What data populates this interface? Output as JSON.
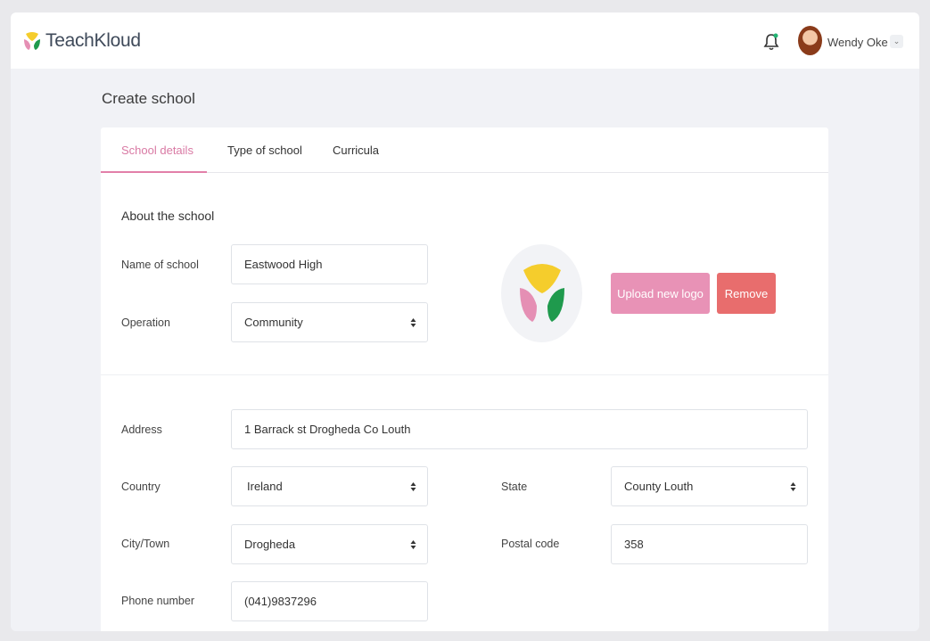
{
  "app": {
    "name": "TeachKloud"
  },
  "user": {
    "name": "Wendy Oke",
    "menu_icon": "⌄"
  },
  "page": {
    "title": "Create school"
  },
  "tabs": [
    {
      "label": "School details",
      "active": true
    },
    {
      "label": "Type of school",
      "active": false
    },
    {
      "label": "Curricula",
      "active": false
    }
  ],
  "about": {
    "title": "About the school",
    "name_label": "Name of school",
    "name_value": "Eastwood High",
    "operation_label": "Operation",
    "operation_value": "Community",
    "upload_label": "Upload new logo",
    "remove_label": "Remove"
  },
  "address": {
    "address_label": "Address",
    "address_value": "1 Barrack st Drogheda Co Louth",
    "country_label": "Country",
    "country_value": "Ireland",
    "state_label": "State",
    "state_value": "County Louth",
    "city_label": "City/Town",
    "city_value": "Drogheda",
    "postal_label": "Postal code",
    "postal_value": "358",
    "phone_label": "Phone number",
    "phone_value": "(041)9837296"
  },
  "colors": {
    "accent_pink": "#e27fa9",
    "button_upload": "#e892b6",
    "button_remove": "#e86d6d",
    "logo_yellow": "#f5cd2c",
    "logo_pink": "#e58fb4",
    "logo_green": "#1f9a4d",
    "notification_dot": "#22b573"
  },
  "icons": {
    "brand": "teachkloud-logo-icon",
    "notification": "bell-icon",
    "select_caret": "up-down-caret-icon"
  }
}
